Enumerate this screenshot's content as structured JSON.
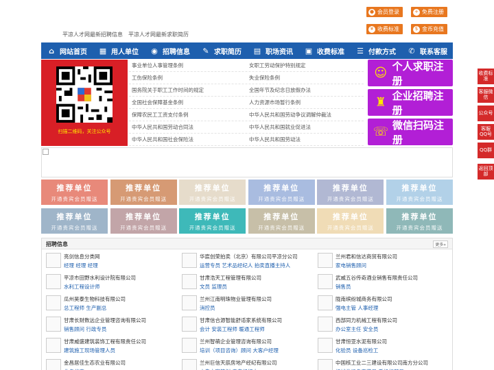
{
  "taglines": [
    "平凉人才网最新招聘信息",
    "平凉人才网最新求职简历"
  ],
  "top_buttons": [
    {
      "label": "会员登录",
      "icon": "user-icon"
    },
    {
      "label": "免费注册",
      "icon": "register-icon"
    },
    {
      "label": "收费标准",
      "icon": "yen-icon"
    },
    {
      "label": "金币充值",
      "icon": "coin-icon"
    }
  ],
  "nav": [
    {
      "label": "网站首页",
      "icon": "home-icon"
    },
    {
      "label": "用人单位",
      "icon": "building-icon"
    },
    {
      "label": "招聘信息",
      "icon": "recruit-icon"
    },
    {
      "label": "求职简历",
      "icon": "resume-icon"
    },
    {
      "label": "职场资讯",
      "icon": "news-icon"
    },
    {
      "label": "收费标准",
      "icon": "fee-icon"
    },
    {
      "label": "付款方式",
      "icon": "payment-icon"
    },
    {
      "label": "联系客服",
      "icon": "phone-icon"
    }
  ],
  "qr_caption": "扫描二维码，关注公众号",
  "policy_links": [
    [
      "事业单位人事管理条例",
      "女职工劳动保护特别规定"
    ],
    [
      "工伤保险条例",
      "失业保险条例"
    ],
    [
      "国务院关于职工工作时间的规定",
      "全国年节及纪念日放假办法"
    ],
    [
      "全国社会保障基金条例",
      "人力资源市场暂行条例"
    ],
    [
      "保障农民工工资支付条例",
      "中华人民共和国劳动争议调解仲裁法"
    ],
    [
      "中华人民共和国劳动合同法",
      "中华人民共和国就业促进法"
    ],
    [
      "中华人民共和国社会保险法",
      "中华人民共和国劳动法"
    ]
  ],
  "register_buttons": [
    {
      "label": "个人求职注册",
      "icon": "person-icon"
    },
    {
      "label": "企业招聘注册",
      "icon": "company-icon"
    },
    {
      "label": "微信扫码注册",
      "icon": "wechat-icon"
    }
  ],
  "recommend": {
    "title": "推荐单位",
    "subtitle": "开通贵宾会员赠送",
    "colors": [
      "#e8897a",
      "#d69a74",
      "#e6dccb",
      "#a9bce0",
      "#b1b8d3",
      "#b2d1e8",
      "#9fb5c9",
      "#c2a5a8",
      "#3eb9b9",
      "#c7bfa8",
      "#f0dcb6",
      "#8fb8b8"
    ]
  },
  "jobs": {
    "title": "招聘信息",
    "more": "更多»",
    "items": [
      {
        "company": "亮剑信息分类网",
        "positions": "经理 经理 经理"
      },
      {
        "company": "华宸创荣拍卖（北京）有限公司平凉分公司",
        "positions": "运营专员 艺术品经纪人 拍卖直播主持人"
      },
      {
        "company": "兰州君和信达商贸有限公司",
        "positions": "家电销售顾问"
      },
      {
        "company": "平凉市田野水利设计院有限公司",
        "positions": "水利工程设计师"
      },
      {
        "company": "甘肃浩天工程管理有限公司",
        "positions": "文员 监理员"
      },
      {
        "company": "武威五谷传奇酒业销售有限责任公司",
        "positions": "销售员"
      },
      {
        "company": "瓜州昊泰生物科技有限公司",
        "positions": "总工程师 生产副总"
      },
      {
        "company": "兰州江南明珠物业管理有限公司",
        "positions": "消控员"
      },
      {
        "company": "陇南缤纷城商务有限公司",
        "positions": "强电主管 人事经理"
      },
      {
        "company": "甘肃长财数远企业管理咨询有限公司",
        "positions": "销售顾问 行政专员"
      },
      {
        "company": "甘肃信合源智能舒适家系统有限公司",
        "positions": "会计 安装工程师 暖通工程师"
      },
      {
        "company": "西部同力机械工程有限公司",
        "positions": "办公室主任 安全员"
      },
      {
        "company": "甘肃威盛建筑装饰工程有限责任公司",
        "positions": "建筑施工现场管理人员"
      },
      {
        "company": "兰州智萌企业管理咨询有限公司",
        "positions": "培训（项目咨询）顾问 大客户经理"
      },
      {
        "company": "甘肃恒亚水泥有限公司",
        "positions": "化验员 设备巡检工"
      },
      {
        "company": "金昌居佳生态农业有限公司",
        "positions": "业务代表"
      },
      {
        "company": "兰州巨信天辰房地产经纪有限公司",
        "positions": "广告文案策划 房产经纪人"
      },
      {
        "company": "中国核工业二三建设有限公司南方分公司",
        "positions": "机械类设备安装员 手机标预员"
      }
    ]
  },
  "side_buttons": [
    {
      "label": "收费标准"
    },
    {
      "label": "客服微信"
    },
    {
      "label": "公众号"
    },
    {
      "label": "客服QQ号"
    },
    {
      "label": "QQ群"
    },
    {
      "label": "返回顶部"
    }
  ]
}
